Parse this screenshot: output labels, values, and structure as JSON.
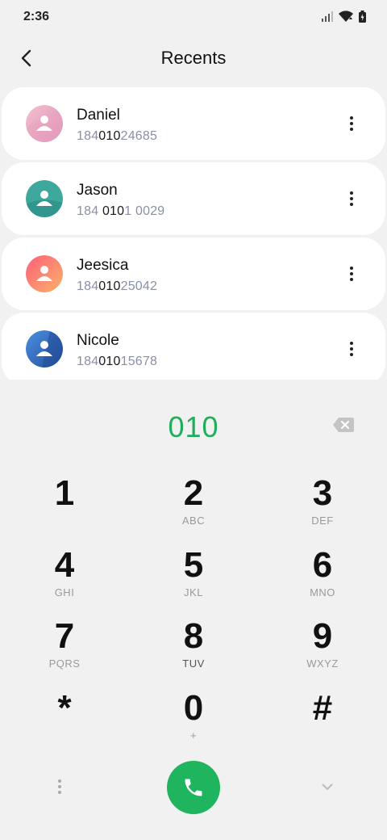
{
  "status_bar": {
    "time": "2:36"
  },
  "header": {
    "title": "Recents"
  },
  "contacts": [
    {
      "name": "Daniel",
      "number_pre": "184",
      "number_match": "010",
      "number_post": "24685",
      "avatar_colors": [
        "#f4b6c2",
        "#d98bb0"
      ]
    },
    {
      "name": "Jason",
      "number_pre": "184 ",
      "number_match": "010",
      "number_post": "1 0029",
      "avatar_colors": [
        "#4fb3a8",
        "#2e8f87"
      ]
    },
    {
      "name": "Jeesica",
      "number_pre": "184",
      "number_match": "010",
      "number_post": "25042",
      "avatar_colors": [
        "#ff6b7a",
        "#f7b36b"
      ]
    },
    {
      "name": "Nicole",
      "number_pre": "184",
      "number_match": "010",
      "number_post": "15678",
      "avatar_colors": [
        "#3d7fd6",
        "#2855a8"
      ]
    }
  ],
  "dialer": {
    "number": "010"
  },
  "keypad": [
    {
      "digit": "1",
      "letters": ""
    },
    {
      "digit": "2",
      "letters": "ABC"
    },
    {
      "digit": "3",
      "letters": "DEF"
    },
    {
      "digit": "4",
      "letters": "GHI"
    },
    {
      "digit": "5",
      "letters": "JKL"
    },
    {
      "digit": "6",
      "letters": "MNO"
    },
    {
      "digit": "7",
      "letters": "PQRS"
    },
    {
      "digit": "8",
      "letters": "TUV"
    },
    {
      "digit": "9",
      "letters": "WXYZ"
    },
    {
      "digit": "*",
      "letters": ""
    },
    {
      "digit": "0",
      "letters": "+"
    },
    {
      "digit": "#",
      "letters": ""
    }
  ],
  "colors": {
    "accent": "#1fb55f",
    "dial_text": "#1fae5c",
    "number_muted": "#8a8fa8"
  },
  "icons": {
    "back": "chevron-left-icon",
    "more": "more-vertical-icon",
    "backspace": "backspace-icon",
    "call": "phone-icon",
    "collapse": "chevron-down-icon"
  }
}
